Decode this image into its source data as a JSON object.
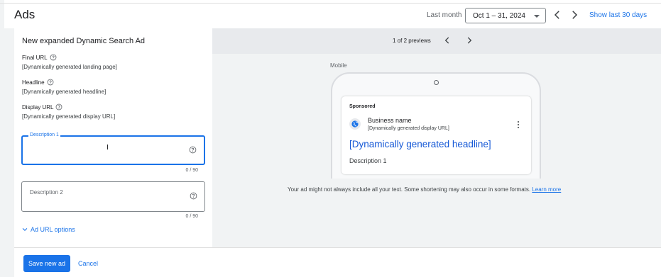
{
  "header": {
    "title": "Ads",
    "date_label": "Last month",
    "date_range": "Oct 1 – 31, 2024",
    "show_last": "Show last 30 days"
  },
  "form": {
    "title": "New expanded Dynamic Search Ad",
    "fields": [
      {
        "label": "Final URL",
        "value": "[Dynamically generated landing page]"
      },
      {
        "label": "Headline",
        "value": "[Dynamically generated headline]"
      },
      {
        "label": "Display URL",
        "value": "[Dynamically generated display URL]"
      }
    ],
    "description1": {
      "label": "Description 1",
      "value": "",
      "counter": "0 / 90"
    },
    "description2": {
      "placeholder": "Description 2",
      "value": "",
      "counter": "0 / 90"
    },
    "url_options_label": "Ad URL options"
  },
  "preview": {
    "count_text": "1 of 2 previews",
    "device_label": "Mobile",
    "ad": {
      "sponsored": "Sponsored",
      "business_name": "Business name",
      "display_url": "[Dynamically generated display URL]",
      "headline": "[Dynamically generated headline]",
      "description": "Description 1"
    },
    "disclaimer": "Your ad might not always include all your text. Some shortening may also occur in some formats.",
    "learn_more": "Learn more"
  },
  "footer": {
    "save_label": "Save new ad",
    "cancel_label": "Cancel"
  },
  "colors": {
    "accent": "#1a73e8",
    "background": "#f1f3f4",
    "surface": "#ffffff"
  },
  "icons": [
    "help-icon",
    "chevron-left-icon",
    "chevron-right-icon",
    "chevron-down-icon",
    "globe-icon",
    "more-vert-icon",
    "text-cursor-icon"
  ]
}
